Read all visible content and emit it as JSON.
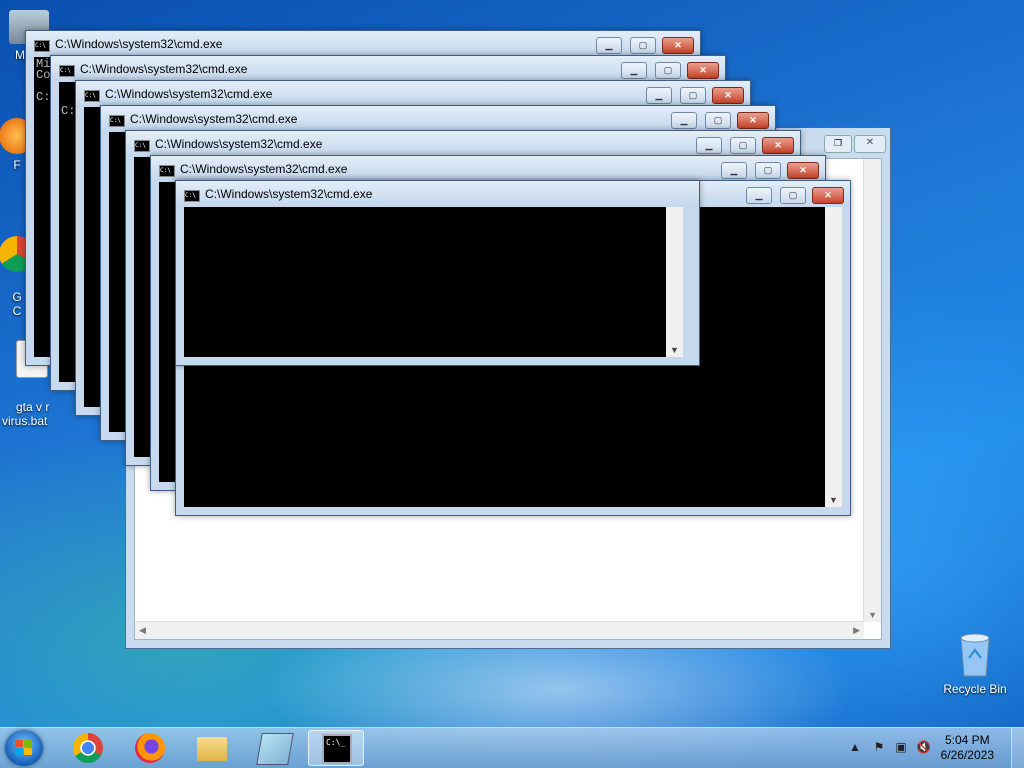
{
  "desktop": {
    "icons": [
      {
        "label": "My C",
        "icon": "computer-icon"
      },
      {
        "label": "F",
        "icon": "firefox-shortcut-icon"
      },
      {
        "label": "G\nC",
        "icon": "chrome-shortcut-icon"
      },
      {
        "label": "gta v r\nvirus.bat",
        "icon": "batch-file-icon"
      },
      {
        "label": "Recycle Bin",
        "icon": "recycle-bin-icon"
      }
    ]
  },
  "cmd_windows": {
    "title": "C:\\Windows\\system32\\cmd.exe",
    "count": 7,
    "first_console_text": "Mi\nCo\n\nC:"
  },
  "cmd_window_2_text": "\n\nC:\\Wi",
  "taskbar": {
    "pinned": [
      {
        "name": "Google Chrome",
        "icon": "chrome-icon"
      },
      {
        "name": "Firefox",
        "icon": "firefox-icon"
      },
      {
        "name": "Windows Explorer",
        "icon": "folder-icon"
      },
      {
        "name": "Notepad",
        "icon": "notepad-icon"
      },
      {
        "name": "Command Prompt",
        "icon": "cmd-icon"
      }
    ],
    "clock_time": "5:04 PM",
    "clock_date": "6/26/2023",
    "tray_icons": [
      "show-hidden-icons-arrow",
      "action-center-icon",
      "network-icon",
      "volume-muted-icon"
    ]
  },
  "colors": {
    "cmd_close": "#c7432a",
    "console_bg": "#000000",
    "desktop_bg": "#1f78d6"
  }
}
